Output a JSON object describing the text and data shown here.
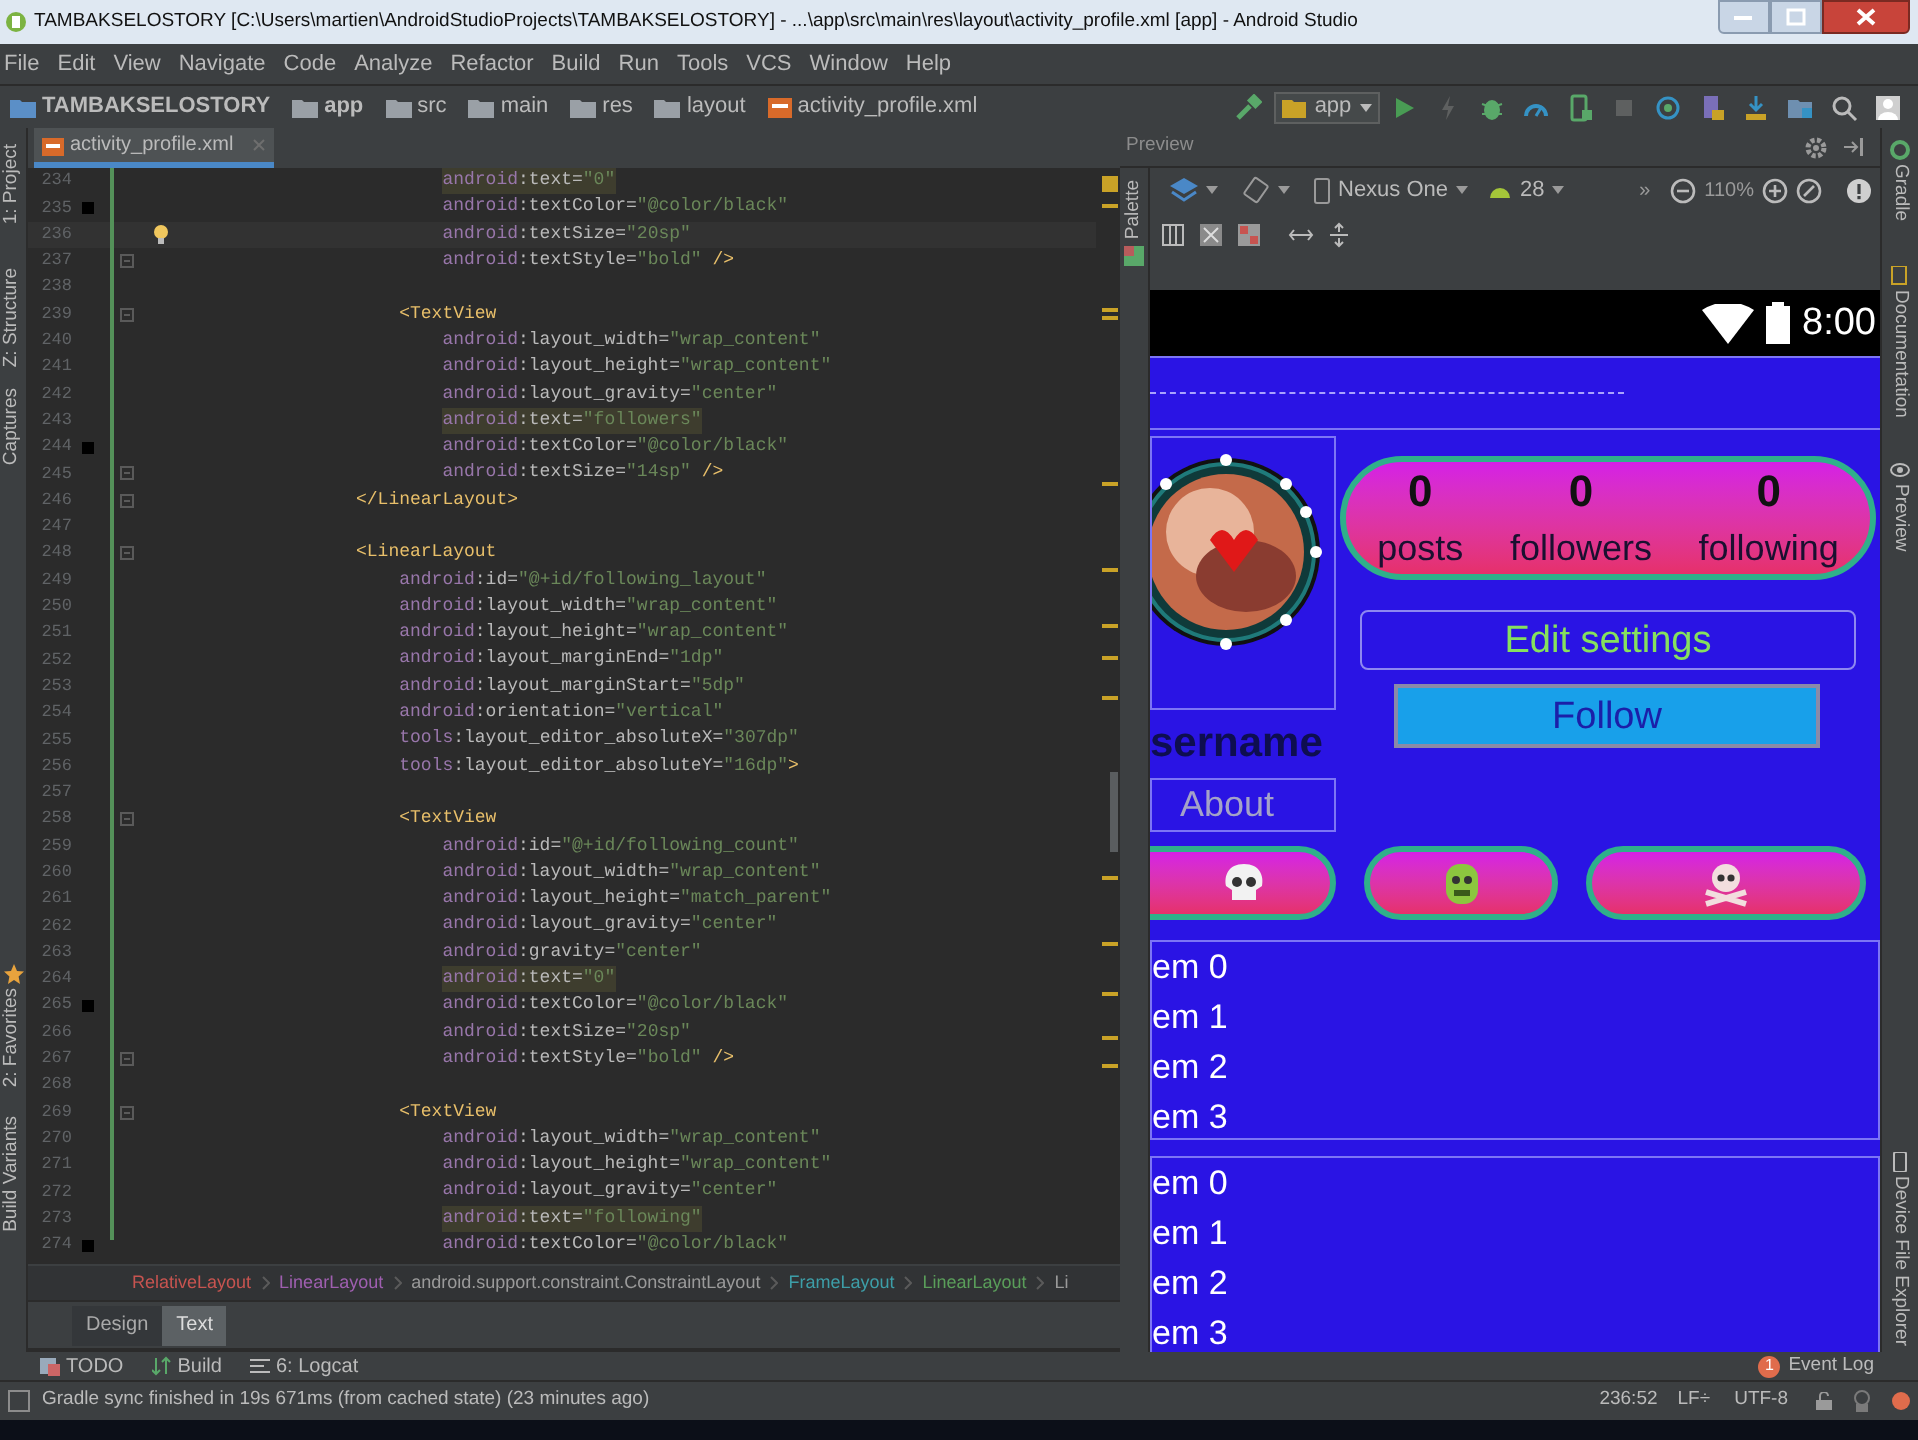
{
  "window": {
    "title": "TAMBAKSELOSTORY [C:\\Users\\martien\\AndroidStudioProjects\\TAMBAKSELOSTORY] - ...\\app\\src\\main\\res\\layout\\activity_profile.xml [app] - Android Studio"
  },
  "menu_bar": [
    "File",
    "Edit",
    "View",
    "Navigate",
    "Code",
    "Analyze",
    "Refactor",
    "Build",
    "Run",
    "Tools",
    "VCS",
    "Window",
    "Help"
  ],
  "nav_bar": {
    "breadcrumbs": [
      {
        "label": "TAMBAKSELOSTORY",
        "kind": "project"
      },
      {
        "label": "app",
        "kind": "module"
      },
      {
        "label": "src",
        "kind": "folder"
      },
      {
        "label": "main",
        "kind": "folder"
      },
      {
        "label": "res",
        "kind": "resources"
      },
      {
        "label": "layout",
        "kind": "folder"
      },
      {
        "label": "activity_profile.xml",
        "kind": "file"
      }
    ],
    "run_config": "app"
  },
  "left_tool_strip": [
    "1: Project",
    "Z: Structure",
    "Captures",
    "2: Favorites",
    "Build Variants"
  ],
  "editor": {
    "tab": {
      "label": "activity_profile.xml",
      "selected": true
    },
    "lines": [
      {
        "number": "234",
        "text": "                            android:text=\"0\"",
        "highlighted": true,
        "current": false,
        "fold": false
      },
      {
        "number": "235",
        "text": "                            android:textColor=\"@color/black\"",
        "highlighted": false,
        "current": false,
        "fold": false,
        "color": "#000000"
      },
      {
        "number": "236",
        "text": "                            android:textSize=\"20sp\"",
        "highlighted": false,
        "current": true,
        "fold": false
      },
      {
        "number": "237",
        "text": "                            android:textStyle=\"bold\" />",
        "highlighted": false,
        "current": false,
        "fold": true
      },
      {
        "number": "238",
        "current": false,
        "fold": false
      },
      {
        "number": "239",
        "text": "                        <TextView",
        "highlighted": false,
        "current": false,
        "fold": true
      },
      {
        "number": "240",
        "text": "                            android:layout_width=\"wrap_content\"",
        "highlighted": false,
        "current": false,
        "fold": false
      },
      {
        "number": "241",
        "text": "                            android:layout_height=\"wrap_content\"",
        "highlighted": false,
        "current": false,
        "fold": false
      },
      {
        "number": "242",
        "text": "                            android:layout_gravity=\"center\"",
        "highlighted": false,
        "current": false,
        "fold": false
      },
      {
        "number": "243",
        "text": "                            android:text=\"followers\"",
        "highlighted": true,
        "current": false,
        "fold": false
      },
      {
        "number": "244",
        "text": "                            android:textColor=\"@color/black\"",
        "highlighted": false,
        "current": false,
        "fold": false,
        "color": "#000000"
      },
      {
        "number": "245",
        "text": "                            android:textSize=\"14sp\" />",
        "highlighted": false,
        "current": false,
        "fold": true
      },
      {
        "number": "246",
        "text": "                    </LinearLayout>",
        "highlighted": false,
        "current": false,
        "fold": true
      },
      {
        "number": "247",
        "current": false,
        "fold": false
      },
      {
        "number": "248",
        "text": "                    <LinearLayout",
        "highlighted": false,
        "current": false,
        "fold": true
      },
      {
        "number": "249",
        "text": "                        android:id=\"@+id/following_layout\"",
        "highlighted": false,
        "current": false,
        "fold": false
      },
      {
        "number": "250",
        "text": "                        android:layout_width=\"wrap_content\"",
        "highlighted": false,
        "current": false,
        "fold": false
      },
      {
        "number": "251",
        "text": "                        android:layout_height=\"wrap_content\"",
        "highlighted": false,
        "current": false,
        "fold": false
      },
      {
        "number": "252",
        "text": "                        android:layout_marginEnd=\"1dp\"",
        "highlighted": false,
        "current": false,
        "fold": false
      },
      {
        "number": "253",
        "text": "                        android:layout_marginStart=\"5dp\"",
        "highlighted": false,
        "current": false,
        "fold": false
      },
      {
        "number": "254",
        "text": "                        android:orientation=\"vertical\"",
        "highlighted": false,
        "current": false,
        "fold": false
      },
      {
        "number": "255",
        "text": "                        tools:layout_editor_absoluteX=\"307dp\"",
        "highlighted": false,
        "current": false,
        "fold": false
      },
      {
        "number": "256",
        "text": "                        tools:layout_editor_absoluteY=\"16dp\">",
        "highlighted": false,
        "current": false,
        "fold": false
      },
      {
        "number": "257",
        "current": false,
        "fold": false
      },
      {
        "number": "258",
        "text": "                        <TextView",
        "highlighted": false,
        "current": false,
        "fold": true
      },
      {
        "number": "259",
        "text": "                            android:id=\"@+id/following_count\"",
        "highlighted": false,
        "current": false,
        "fold": false
      },
      {
        "number": "260",
        "text": "                            android:layout_width=\"wrap_content\"",
        "highlighted": false,
        "current": false,
        "fold": false
      },
      {
        "number": "261",
        "text": "                            android:layout_height=\"match_parent\"",
        "highlighted": false,
        "current": false,
        "fold": false
      },
      {
        "number": "262",
        "text": "                            android:layout_gravity=\"center\"",
        "highlighted": false,
        "current": false,
        "fold": false
      },
      {
        "number": "263",
        "text": "                            android:gravity=\"center\"",
        "highlighted": false,
        "current": false,
        "fold": false
      },
      {
        "number": "264",
        "text": "                            android:text=\"0\"",
        "highlighted": true,
        "current": false,
        "fold": false
      },
      {
        "number": "265",
        "text": "                            android:textColor=\"@color/black\"",
        "highlighted": false,
        "current": false,
        "fold": false,
        "color": "#000000"
      },
      {
        "number": "266",
        "text": "                            android:textSize=\"20sp\"",
        "highlighted": false,
        "current": false,
        "fold": false
      },
      {
        "number": "267",
        "text": "                            android:textStyle=\"bold\" />",
        "highlighted": false,
        "current": false,
        "fold": true
      },
      {
        "number": "268",
        "current": false,
        "fold": false
      },
      {
        "number": "269",
        "text": "                        <TextView",
        "highlighted": false,
        "current": false,
        "fold": true
      },
      {
        "number": "270",
        "text": "                            android:layout_width=\"wrap_content\"",
        "highlighted": false,
        "current": false,
        "fold": false
      },
      {
        "number": "271",
        "text": "                            android:layout_height=\"wrap_content\"",
        "highlighted": false,
        "current": false,
        "fold": false
      },
      {
        "number": "272",
        "text": "                            android:layout_gravity=\"center\"",
        "highlighted": false,
        "current": false,
        "fold": false
      },
      {
        "number": "273",
        "text": "                            android:text=\"following\"",
        "highlighted": true,
        "current": false,
        "fold": false
      },
      {
        "number": "274",
        "text": "                            android:textColor=\"@color/black\"",
        "highlighted": false,
        "current": false,
        "fold": false,
        "color": "#000000"
      }
    ],
    "breadcrumbs": [
      {
        "label": "RelativeLayout",
        "color": "#c75450"
      },
      {
        "label": "LinearLayout",
        "color": "#9f5fb0"
      },
      {
        "label": "android.support.constraint.ConstraintLayout",
        "color": "#9a9a9a"
      },
      {
        "label": "FrameLayout",
        "color": "#3d9ea8"
      },
      {
        "label": "LinearLayout",
        "color": "#5a9e5a"
      },
      {
        "label": "Li",
        "color": "#9a9a9a"
      }
    ],
    "mode_tabs": [
      {
        "label": "Design",
        "selected": false
      },
      {
        "label": "Text",
        "selected": true
      }
    ]
  },
  "preview": {
    "title": "Preview",
    "palette": "Palette",
    "device": "Nexus One",
    "api": "28",
    "overflow": "»",
    "zoom": "110%",
    "phone": {
      "clock": "8:00",
      "stats": [
        {
          "count": "0",
          "label": "posts"
        },
        {
          "count": "0",
          "label": "followers"
        },
        {
          "count": "0",
          "label": "following"
        }
      ],
      "edit_button": "Edit settings",
      "follow_button": "Follow",
      "username": "sername",
      "about": "About",
      "lists": [
        [
          "em 0",
          "em 1",
          "em 2",
          "em 3"
        ],
        [
          "em 0",
          "em 1",
          "em 2",
          "em 3"
        ]
      ]
    }
  },
  "right_tool_strip": [
    "Gradle",
    "Documentation",
    "Preview",
    "Device File Explorer"
  ],
  "tool_windows": [
    "TODO",
    "Build",
    "6: Logcat"
  ],
  "event_log": {
    "label": "Event Log",
    "count": "1"
  },
  "status_bar": {
    "message": "Gradle sync finished in 19s 671ms (from cached state) (23 minutes ago)",
    "position": "236:52",
    "line_separator": "LF÷",
    "encoding": "UTF-8"
  }
}
